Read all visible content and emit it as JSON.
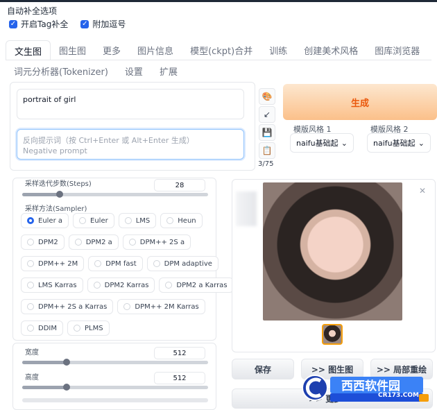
{
  "autocomplete": {
    "title": "自动补全选项",
    "options": [
      {
        "label": "开启Tag补全",
        "checked": true
      },
      {
        "label": "附加逗号",
        "checked": true
      }
    ]
  },
  "tabs_row1": [
    "文生图",
    "图生图",
    "更多",
    "图片信息",
    "模型(ckpt)合并",
    "训练",
    "创建美术风格",
    "图库浏览器"
  ],
  "tabs_row2": [
    "词元分析器(Tokenizer)",
    "设置",
    "扩展"
  ],
  "prompt": {
    "value": "portrait of girl",
    "negative_placeholder_line1": "反向提示词（按 Ctrl+Enter 或 Alt+Enter 生成）",
    "negative_placeholder_line2": "Negative prompt",
    "token_count": "3/75"
  },
  "tool_icons": [
    "palette-icon",
    "arrow-down-left-icon",
    "save-icon",
    "clipboard-icon"
  ],
  "generate": {
    "label": "生成"
  },
  "styles": [
    {
      "label": "模版风格 1",
      "value": "naifu基础起"
    },
    {
      "label": "模版风格 2",
      "value": "naifu基础起"
    }
  ],
  "steps": {
    "label": "采样迭代步数(Steps)",
    "value": "28",
    "fill": 0.2
  },
  "sampler": {
    "label": "采样方法(Sampler)",
    "selected": "Euler a",
    "rows": [
      [
        "Euler a",
        "Euler",
        "LMS",
        "Heun"
      ],
      [
        "DPM2",
        "DPM2 a",
        "DPM++ 2S a"
      ],
      [
        "DPM++ 2M",
        "DPM fast",
        "DPM adaptive"
      ],
      [
        "LMS Karras",
        "DPM2 Karras",
        "DPM2 a Karras"
      ],
      [
        "DPM++ 2S a Karras",
        "DPM++ 2M Karras"
      ],
      [
        "DDIM",
        "PLMS"
      ]
    ]
  },
  "width": {
    "label": "宽度",
    "value": "512",
    "fill": 0.24
  },
  "height": {
    "label": "高度",
    "value": "512",
    "fill": 0.24
  },
  "actions": {
    "save": "保存",
    "img2img": ">> 图生图",
    "inpaint": ">> 局部重绘",
    "more": ">> 更多"
  },
  "watermark": {
    "text": "西西软件园",
    "url": "CR173.COM"
  },
  "colors": {
    "accent": "#2563eb",
    "generate_text": "#ea580c"
  }
}
